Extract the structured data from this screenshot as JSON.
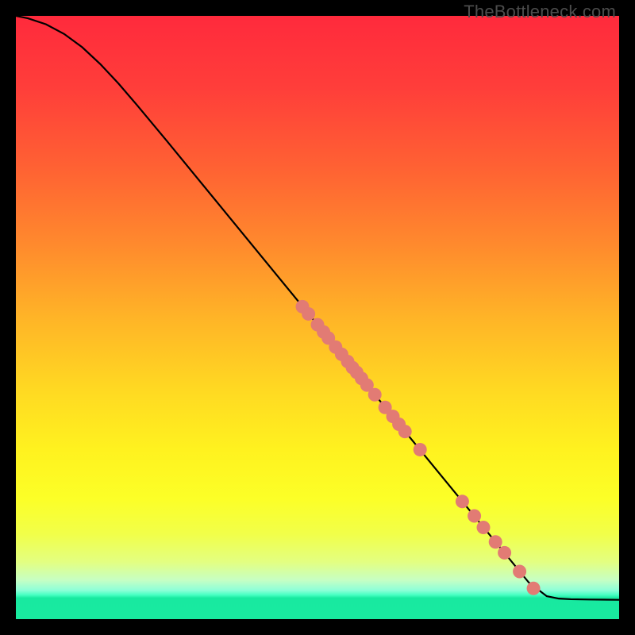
{
  "watermark": "TheBottleneck.com",
  "colors": {
    "point_fill": "#e27b74",
    "curve_stroke": "#000000",
    "frame_bg": "#000000",
    "gradient_stops": [
      {
        "offset": 0.0,
        "color": "#ff2a3c"
      },
      {
        "offset": 0.12,
        "color": "#ff3e3a"
      },
      {
        "offset": 0.25,
        "color": "#ff6133"
      },
      {
        "offset": 0.38,
        "color": "#ff8a2d"
      },
      {
        "offset": 0.5,
        "color": "#ffb427"
      },
      {
        "offset": 0.62,
        "color": "#ffd922"
      },
      {
        "offset": 0.72,
        "color": "#fff21f"
      },
      {
        "offset": 0.8,
        "color": "#fcff27"
      },
      {
        "offset": 0.86,
        "color": "#f1ff4a"
      },
      {
        "offset": 0.905,
        "color": "#e3ff81"
      },
      {
        "offset": 0.935,
        "color": "#c7ffc3"
      },
      {
        "offset": 0.952,
        "color": "#8effd8"
      },
      {
        "offset": 0.96,
        "color": "#46ffc2"
      },
      {
        "offset": 0.965,
        "color": "#18e9a0"
      },
      {
        "offset": 1.0,
        "color": "#19ea9f"
      }
    ]
  },
  "chart_data": {
    "type": "line",
    "title": "",
    "xlabel": "",
    "ylabel": "",
    "xlim": [
      0,
      100
    ],
    "ylim": [
      0,
      100
    ],
    "grid": false,
    "series": [
      {
        "name": "curve",
        "x": [
          0.0,
          2.0,
          5.0,
          8.0,
          11.0,
          14.0,
          17.0,
          20.0,
          25.0,
          30.0,
          35.0,
          40.0,
          45.0,
          50.0,
          55.0,
          60.0,
          65.0,
          70.0,
          75.0,
          80.0,
          85.0,
          88.0,
          90.0,
          92.0,
          95.0,
          100.0
        ],
        "y": [
          100.0,
          99.6,
          98.6,
          97.0,
          94.8,
          92.0,
          88.8,
          85.3,
          79.3,
          73.2,
          67.1,
          61.0,
          54.9,
          48.8,
          42.7,
          36.6,
          30.5,
          24.4,
          18.3,
          12.2,
          6.1,
          3.8,
          3.4,
          3.3,
          3.25,
          3.2
        ]
      }
    ],
    "points": {
      "name": "markers",
      "x": [
        47.5,
        48.5,
        50.0,
        51.0,
        51.8,
        53.0,
        54.0,
        55.0,
        55.8,
        56.5,
        57.3,
        58.2,
        59.5,
        61.2,
        62.5,
        63.5,
        64.5,
        67.0,
        74.0,
        76.0,
        77.5,
        79.5,
        81.0,
        83.5,
        85.8
      ],
      "y": [
        51.8,
        50.6,
        48.8,
        47.6,
        46.6,
        45.1,
        43.9,
        42.7,
        41.7,
        40.9,
        39.9,
        38.8,
        37.2,
        35.1,
        33.6,
        32.3,
        31.1,
        28.1,
        19.5,
        17.1,
        15.2,
        12.8,
        11.0,
        7.9,
        5.1
      ]
    }
  }
}
